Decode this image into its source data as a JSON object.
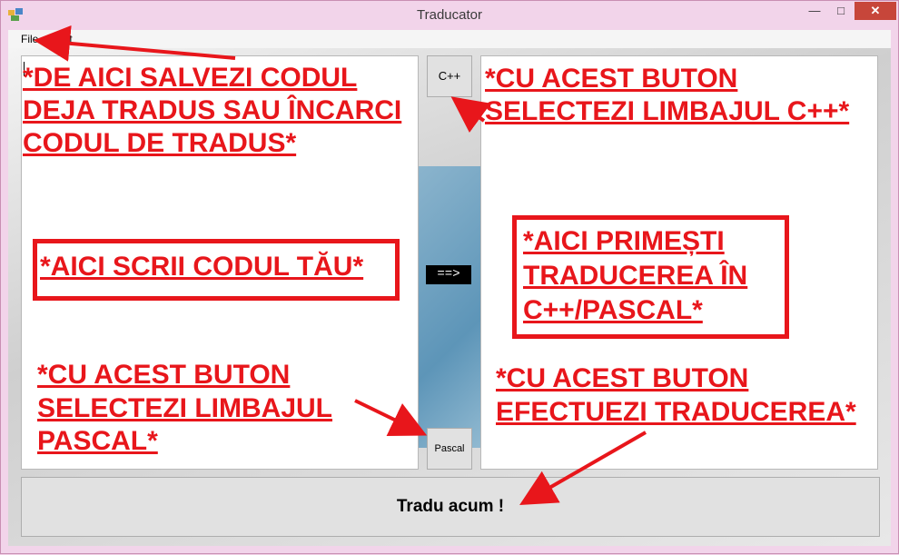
{
  "window": {
    "title": "Traducator",
    "minimize_glyph": "—",
    "maximize_glyph": "□",
    "close_glyph": "✕"
  },
  "menu": {
    "file": "File",
    "edit": "Edit"
  },
  "buttons": {
    "cpp": "C++",
    "pascal": "Pascal",
    "translate": "Tradu acum !"
  },
  "arrow_label": "==>",
  "annotations": {
    "save_load": [
      "*DE AICI SALVEZI CODUL",
      "DEJA TRADUS SAU ÎNCARCI",
      "CODUL DE TRADUS*"
    ],
    "write_code": "*AICI SCRII CODUL TĂU*",
    "cpp_button": [
      "*CU ACEST BUTON",
      "SELECTEZI LIMBAJUL C++*"
    ],
    "result": [
      "*AICI PRIMEȘTI",
      "TRADUCEREA ÎN",
      "C++/PASCAL*"
    ],
    "pascal_button": [
      "*CU ACEST BUTON",
      "SELECTEZI LIMBAJUL",
      "PASCAL*"
    ],
    "translate_button": [
      "*CU ACEST BUTON",
      "EFECTUEZI TRADUCEREA*"
    ]
  },
  "colors": {
    "annotation": "#e8161b",
    "close_button": "#c7463a"
  },
  "icons": [
    "app-icon",
    "minimize-icon",
    "maximize-icon",
    "close-icon"
  ]
}
